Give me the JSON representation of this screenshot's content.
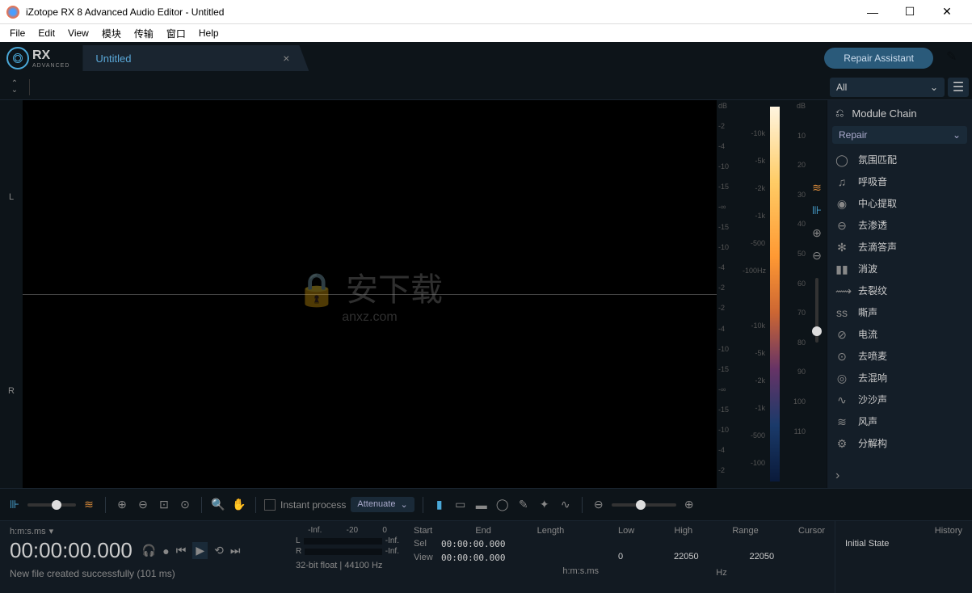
{
  "window": {
    "title": "iZotope RX 8 Advanced Audio Editor - Untitled"
  },
  "menu": [
    "File",
    "Edit",
    "View",
    "模块",
    "传输",
    "窗口",
    "Help"
  ],
  "logo": {
    "text": "RX",
    "sub": "ADVANCED"
  },
  "tab": {
    "title": "Untitled"
  },
  "repair_assistant": "Repair Assistant",
  "channels": [
    "L",
    "R"
  ],
  "db_ticks_left": [
    "dB",
    "-2",
    "-4",
    "-10",
    "-15",
    "-∞",
    "-15",
    "-10",
    "-4",
    "-2",
    "-2",
    "-4",
    "-10",
    "-15",
    "-∞",
    "-15",
    "-10",
    "-4",
    "-2"
  ],
  "freq_ticks": [
    "",
    "-10k",
    "-5k",
    "-2k",
    "-1k",
    "-500",
    "-100Hz",
    "",
    "-10k",
    "-5k",
    "-2k",
    "-1k",
    "-500",
    "-100"
  ],
  "spectrum_ticks": [
    "dB",
    "10",
    "20",
    "30",
    "40",
    "50",
    "60",
    "70",
    "80",
    "90",
    "100",
    "110",
    ""
  ],
  "toolbar": {
    "instant_process": "Instant process",
    "attenuate": "Attenuate"
  },
  "filter": {
    "all": "All"
  },
  "module_chain": "Module Chain",
  "category": "Repair",
  "modules": [
    {
      "icon": "◯",
      "label": "氛围匹配"
    },
    {
      "icon": "♫",
      "label": "呼吸音"
    },
    {
      "icon": "◉",
      "label": "中心提取"
    },
    {
      "icon": "⊖",
      "label": "去渗透"
    },
    {
      "icon": "✻",
      "label": "去滴答声"
    },
    {
      "icon": "▮▮",
      "label": "消波"
    },
    {
      "icon": "⟿",
      "label": "去裂纹"
    },
    {
      "icon": "ss",
      "label": "嘶声"
    },
    {
      "icon": "⊘",
      "label": "电流"
    },
    {
      "icon": "⊙",
      "label": "去喷麦"
    },
    {
      "icon": "◎",
      "label": "去混响"
    },
    {
      "icon": "∿",
      "label": "沙沙声"
    },
    {
      "icon": "≋",
      "label": "风声"
    },
    {
      "icon": "⚙",
      "label": "分解构"
    }
  ],
  "transport": {
    "time_unit": "h:m:s.ms",
    "big_time": "00:00:00.000",
    "status": "New file created successfully (101 ms)"
  },
  "meters": {
    "labels": [
      "-Inf.",
      "-20",
      "0"
    ],
    "L": "L",
    "R": "R",
    "L_val": "-Inf.",
    "R_val": "-Inf.",
    "format": "32-bit float | 44100 Hz"
  },
  "info": {
    "headers": [
      "Start",
      "End",
      "Length"
    ],
    "sel_label": "Sel",
    "sel_value": "00:00:00.000",
    "view_label": "View",
    "view_value": "00:00:00.000",
    "unit": "h:m:s.ms"
  },
  "range": {
    "headers": [
      "Low",
      "High",
      "Range",
      "Cursor"
    ],
    "low": "0",
    "high": "22050",
    "range_v": "22050",
    "cursor": "",
    "unit": "Hz"
  },
  "history": {
    "title": "History",
    "initial": "Initial State"
  }
}
